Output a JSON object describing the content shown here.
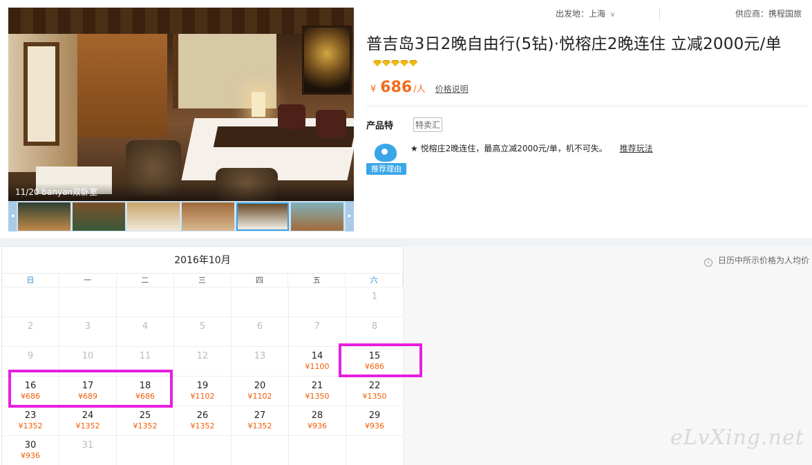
{
  "gallery": {
    "caption": "11/20 banyan双卧室",
    "thumbnails": [
      {
        "colors": [
          "#2f3f30",
          "#c08a4a"
        ]
      },
      {
        "colors": [
          "#7a4f2a",
          "#3a5a3a"
        ]
      },
      {
        "colors": [
          "#c9a36a",
          "#f0ead8"
        ]
      },
      {
        "colors": [
          "#a06a3a",
          "#d8b890"
        ]
      },
      {
        "colors": [
          "#6a4a2a",
          "#f2eee6"
        ],
        "active": true
      },
      {
        "colors": [
          "#7fb1b8",
          "#a26a3a"
        ]
      }
    ],
    "prev_icon": "chevron-left-icon",
    "next_icon": "chevron-right-icon"
  },
  "header": {
    "departure": "出发地：上海",
    "supplier": "供应商：携程国旅"
  },
  "product": {
    "title": "普吉岛3日2晚自由行(5钻)·悦榕庄2晚连住 立减2000元/单",
    "diamond_count": 5,
    "currency": "¥",
    "price": "686",
    "unit": "/人",
    "price_note": "价格说明",
    "features_label": "产品特",
    "feature_tag": "特卖汇",
    "mascot_label": "推荐理由",
    "reason": "★ 悦榕庄2晚连住，最高立减2000元/单，机不可失。",
    "reason_link": "推荐玩法"
  },
  "calendar": {
    "month": "2016年10月",
    "weekdays": [
      "日",
      "一",
      "二",
      "三",
      "四",
      "五",
      "六"
    ],
    "note": "日历中所示价格为人均价",
    "weeks": [
      [
        {
          "d": ""
        },
        {
          "d": ""
        },
        {
          "d": ""
        },
        {
          "d": ""
        },
        {
          "d": ""
        },
        {
          "d": ""
        },
        {
          "d": "1",
          "off": true
        }
      ],
      [
        {
          "d": "2",
          "off": true
        },
        {
          "d": "3",
          "off": true
        },
        {
          "d": "4",
          "off": true
        },
        {
          "d": "5",
          "off": true
        },
        {
          "d": "6",
          "off": true
        },
        {
          "d": "7",
          "off": true
        },
        {
          "d": "8",
          "off": true
        }
      ],
      [
        {
          "d": "9",
          "off": true
        },
        {
          "d": "10",
          "off": true
        },
        {
          "d": "11",
          "off": true
        },
        {
          "d": "12",
          "off": true
        },
        {
          "d": "13",
          "off": true
        },
        {
          "d": "14",
          "p": "¥1100"
        },
        {
          "d": "15",
          "p": "¥686"
        }
      ],
      [
        {
          "d": "16",
          "p": "¥686"
        },
        {
          "d": "17",
          "p": "¥689"
        },
        {
          "d": "18",
          "p": "¥686"
        },
        {
          "d": "19",
          "p": "¥1102"
        },
        {
          "d": "20",
          "p": "¥1102"
        },
        {
          "d": "21",
          "p": "¥1350"
        },
        {
          "d": "22",
          "p": "¥1350"
        }
      ],
      [
        {
          "d": "23",
          "p": "¥1352"
        },
        {
          "d": "24",
          "p": "¥1352"
        },
        {
          "d": "25",
          "p": "¥1352"
        },
        {
          "d": "26",
          "p": "¥1352"
        },
        {
          "d": "27",
          "p": "¥1352"
        },
        {
          "d": "28",
          "p": "¥936"
        },
        {
          "d": "29",
          "p": "¥936"
        }
      ],
      [
        {
          "d": "30",
          "p": "¥936"
        },
        {
          "d": "31",
          "off": true
        },
        {
          "d": ""
        },
        {
          "d": ""
        },
        {
          "d": ""
        },
        {
          "d": ""
        },
        {
          "d": ""
        }
      ]
    ]
  },
  "colors": {
    "price": "#f25c05",
    "highlight": "#e81ee0",
    "weekend": "#2b8fd6",
    "accent_blue": "#3aa6e8"
  },
  "watermark": "eLvXing.net"
}
